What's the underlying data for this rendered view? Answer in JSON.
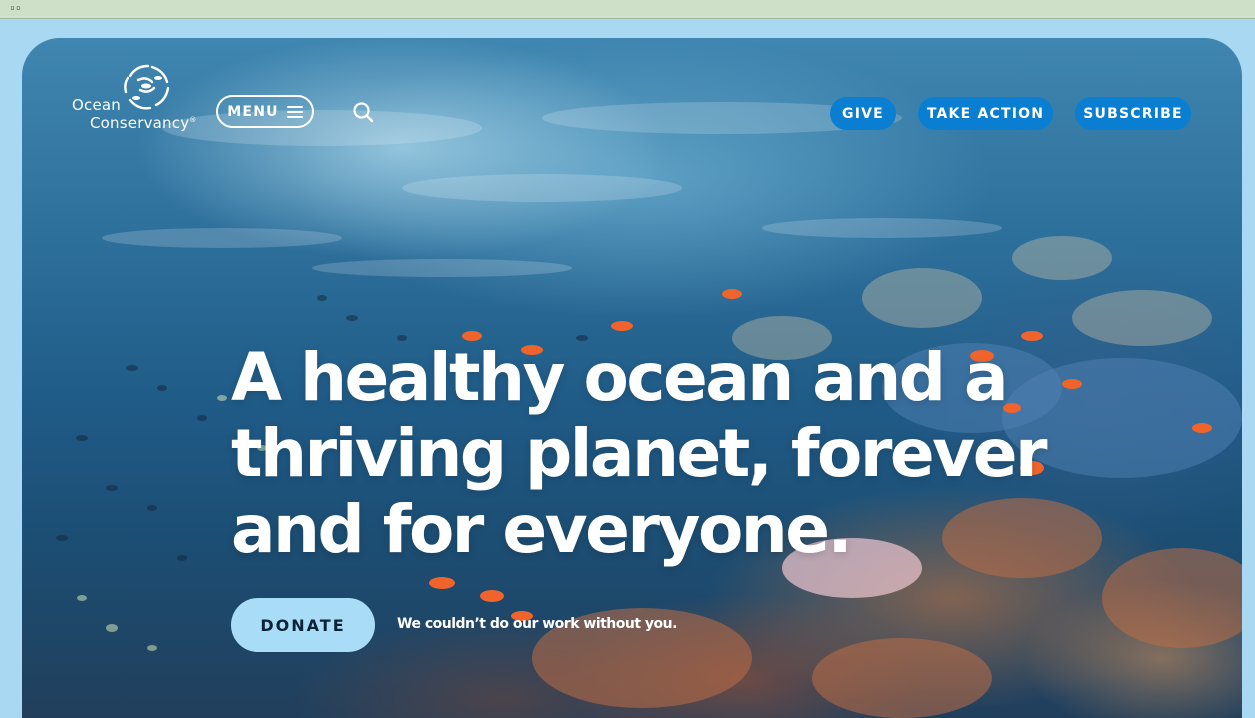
{
  "browser": {
    "chrome_glyph": "▫▫"
  },
  "logo": {
    "line1": "Ocean",
    "line2": "Conservancy",
    "trademark": "®"
  },
  "nav": {
    "menu_label": "MENU",
    "give_label": "GIVE",
    "take_action_label": "TAKE ACTION",
    "subscribe_label": "SUBSCRIBE"
  },
  "hero": {
    "headline_lines": [
      "A healthy ocean and a",
      "thriving planet, forever",
      "and for everyone."
    ],
    "donate_label": "DONATE",
    "donate_note": "We couldn’t do our work without you."
  },
  "colors": {
    "accent": "#0a7fd1",
    "donate_bg": "#a9dcf7",
    "page_bg": "#a9d8f2",
    "text_light": "#ffffff"
  },
  "icons": {
    "logo": "ocean-conservancy-fish-circle-logo",
    "menu": "hamburger-icon",
    "search": "search-icon"
  }
}
